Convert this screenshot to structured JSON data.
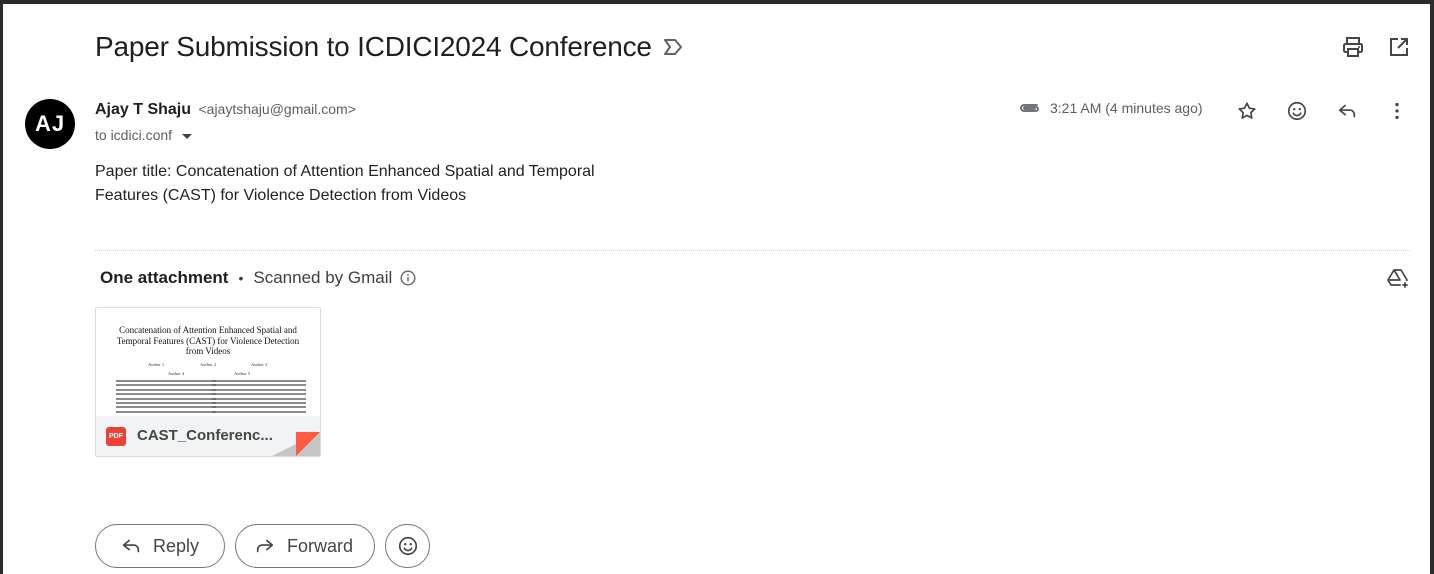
{
  "email": {
    "subject": "Paper Submission to ICDICI2024 Conference",
    "sender": {
      "initials": "AJ",
      "name": "Ajay T Shaju",
      "email": "<ajaytshaju@gmail.com>",
      "to": "to icdici.conf"
    },
    "time": "3:21 AM (4 minutes ago)",
    "body_lines": [
      "Paper title: Concatenation of Attention Enhanced Spatial and Temporal",
      "Features (CAST) for Violence Detection from Videos"
    ]
  },
  "attachments": {
    "heading": "One attachment",
    "scan_text": "Scanned by Gmail",
    "file": {
      "name": "CAST_Conferenc...",
      "type_badge": "PDF",
      "preview_title": "Concatenation of Attention Enhanced Spatial and Temporal Features (CAST) for Violence Detection from Videos",
      "preview_authors": [
        "Author 1",
        "Author 2",
        "Author 3",
        "Author 4",
        "Author 5"
      ]
    }
  },
  "actions": {
    "reply": "Reply",
    "forward": "Forward"
  },
  "icons": {
    "label": "label-icon",
    "print": "print-icon",
    "open_new_window": "open-in-new-window-icon",
    "attachment": "paperclip-icon",
    "star": "star-icon",
    "emoji": "emoji-icon",
    "reply": "reply-icon",
    "more": "more-vert-icon",
    "info": "info-icon",
    "drive": "add-to-drive-icon",
    "forward": "forward-icon"
  },
  "colors": {
    "avatar_bg": "#000000",
    "pdf_red": "#ea4335",
    "corner_red": "#ff5b41"
  }
}
